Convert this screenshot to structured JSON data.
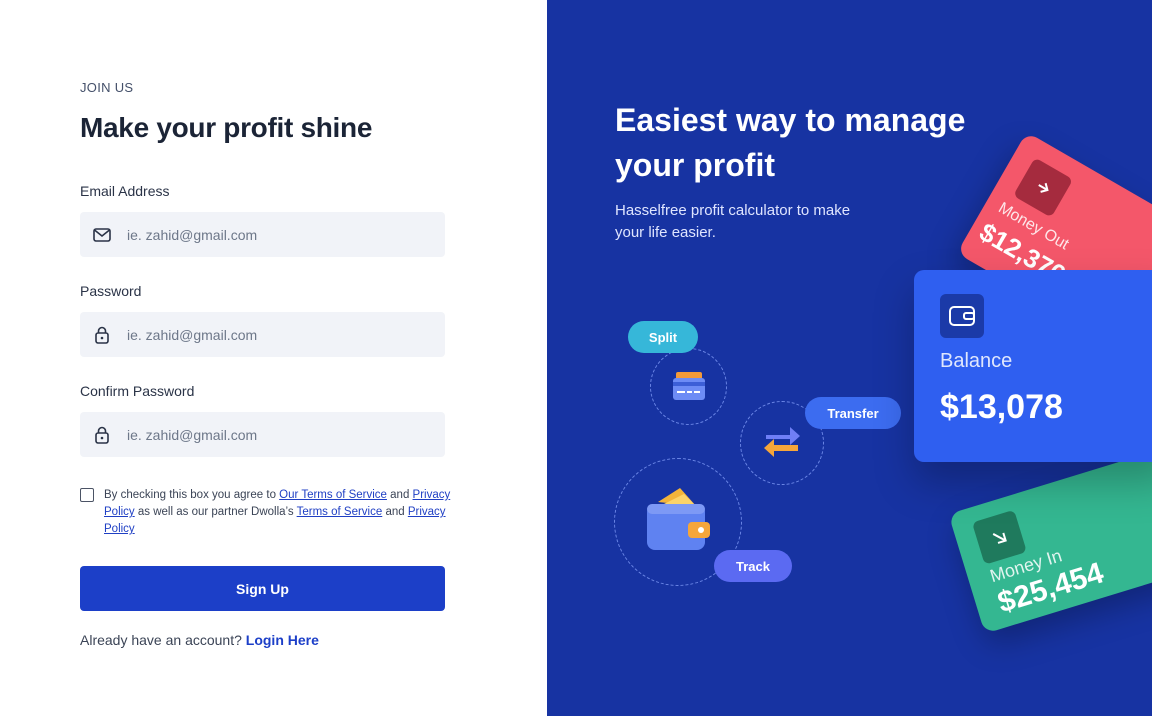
{
  "signup": {
    "eyebrow": "JOIN US",
    "title": "Make your profit shine",
    "fields": [
      {
        "label": "Email Address",
        "placeholder": "ie. zahid@gmail.com",
        "icon": "mail-icon"
      },
      {
        "label": "Password",
        "placeholder": "ie. zahid@gmail.com",
        "icon": "lock-icon"
      },
      {
        "label": "Confirm Password",
        "placeholder": "ie. zahid@gmail.com",
        "icon": "lock-icon"
      }
    ],
    "agreement": {
      "prefix": "By checking this box you agree to ",
      "terms_link": "Our Terms of Service",
      "and_1": " and ",
      "privacy_link": "Privacy Policy",
      "middle": " as well as our partner Dwolla’s ",
      "partner_terms_link": "Terms of Service",
      "and_2": " and ",
      "partner_privacy_link": "Privacy Policy"
    },
    "button_label": "Sign Up",
    "already_text": "Already have an account?",
    "login_link": "Login Here"
  },
  "promo": {
    "title": "Easiest way to manage your profit",
    "subtitle": "Hasselfree profit calculator to make your life easier.",
    "pills": {
      "split": "Split",
      "transfer": "Transfer",
      "track": "Track"
    },
    "cards": {
      "money_out": {
        "label": "Money Out",
        "amount": "$12,376"
      },
      "balance": {
        "label": "Balance",
        "amount": "$13,078"
      },
      "money_in": {
        "label": "Money In",
        "amount": "$25,454"
      }
    }
  },
  "colors": {
    "primary": "#1c3fc8",
    "promo_bg": "#1733a2",
    "money_out": "#f4576a",
    "balance": "#2f5ff0",
    "money_in": "#34b791"
  }
}
